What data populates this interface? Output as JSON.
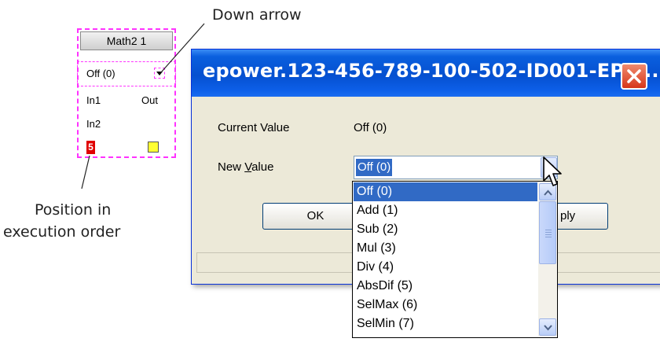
{
  "annotations": {
    "down_arrow": "Down arrow",
    "position_line1": "Position in",
    "position_line2": "execution order"
  },
  "block": {
    "title": "Math2 1",
    "value": "Off (0)",
    "in1": "In1",
    "out": "Out",
    "in2": "In2",
    "exec_order": "5",
    "colors": {
      "dashed_border": "#ff33ff",
      "exec_badge": "#e00000",
      "output_square": "#ffff33"
    }
  },
  "dialog": {
    "title": "epower.123-456-789-100-502-ID001-EPo...",
    "current_value_label": "Current Value",
    "current_value": "Off (0)",
    "new_value_label": "New Value",
    "new_value_selected": "Off (0)",
    "ok_label": "OK",
    "apply_label_visible": "ply",
    "colors": {
      "titlebar": "#0550d0",
      "selection": "#316ac5",
      "close": "#d6361a"
    }
  },
  "dropdown": {
    "options": [
      "Off (0)",
      "Add (1)",
      "Sub (2)",
      "Mul (3)",
      "Div (4)",
      "AbsDif (5)",
      "SelMax (6)",
      "SelMin (7)"
    ],
    "selected_index": 0
  },
  "icons": [
    "close-icon",
    "chevron-down-icon",
    "chevron-up-icon",
    "mouse-cursor-icon"
  ]
}
